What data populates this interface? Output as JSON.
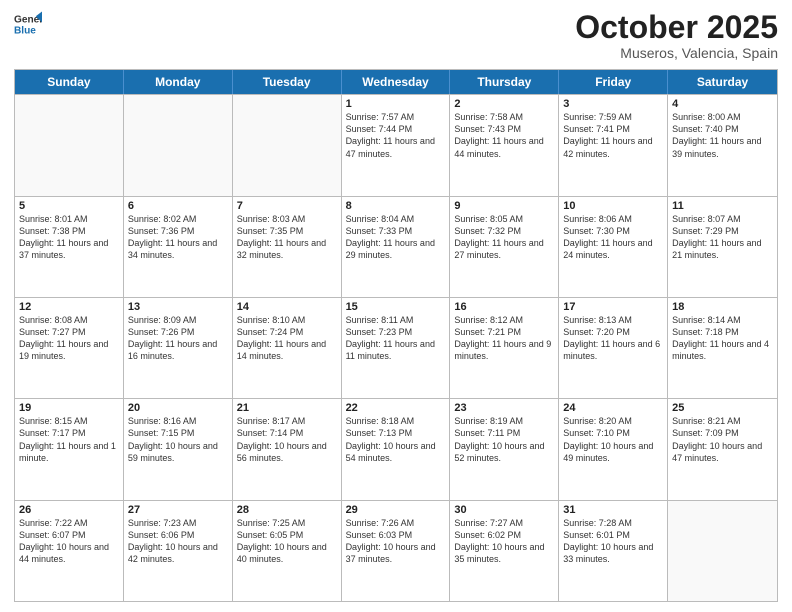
{
  "header": {
    "logo_general": "General",
    "logo_blue": "Blue",
    "month": "October 2025",
    "location": "Museros, Valencia, Spain"
  },
  "days_of_week": [
    "Sunday",
    "Monday",
    "Tuesday",
    "Wednesday",
    "Thursday",
    "Friday",
    "Saturday"
  ],
  "weeks": [
    [
      {
        "day": "",
        "info": ""
      },
      {
        "day": "",
        "info": ""
      },
      {
        "day": "",
        "info": ""
      },
      {
        "day": "1",
        "info": "Sunrise: 7:57 AM\nSunset: 7:44 PM\nDaylight: 11 hours and 47 minutes."
      },
      {
        "day": "2",
        "info": "Sunrise: 7:58 AM\nSunset: 7:43 PM\nDaylight: 11 hours and 44 minutes."
      },
      {
        "day": "3",
        "info": "Sunrise: 7:59 AM\nSunset: 7:41 PM\nDaylight: 11 hours and 42 minutes."
      },
      {
        "day": "4",
        "info": "Sunrise: 8:00 AM\nSunset: 7:40 PM\nDaylight: 11 hours and 39 minutes."
      }
    ],
    [
      {
        "day": "5",
        "info": "Sunrise: 8:01 AM\nSunset: 7:38 PM\nDaylight: 11 hours and 37 minutes."
      },
      {
        "day": "6",
        "info": "Sunrise: 8:02 AM\nSunset: 7:36 PM\nDaylight: 11 hours and 34 minutes."
      },
      {
        "day": "7",
        "info": "Sunrise: 8:03 AM\nSunset: 7:35 PM\nDaylight: 11 hours and 32 minutes."
      },
      {
        "day": "8",
        "info": "Sunrise: 8:04 AM\nSunset: 7:33 PM\nDaylight: 11 hours and 29 minutes."
      },
      {
        "day": "9",
        "info": "Sunrise: 8:05 AM\nSunset: 7:32 PM\nDaylight: 11 hours and 27 minutes."
      },
      {
        "day": "10",
        "info": "Sunrise: 8:06 AM\nSunset: 7:30 PM\nDaylight: 11 hours and 24 minutes."
      },
      {
        "day": "11",
        "info": "Sunrise: 8:07 AM\nSunset: 7:29 PM\nDaylight: 11 hours and 21 minutes."
      }
    ],
    [
      {
        "day": "12",
        "info": "Sunrise: 8:08 AM\nSunset: 7:27 PM\nDaylight: 11 hours and 19 minutes."
      },
      {
        "day": "13",
        "info": "Sunrise: 8:09 AM\nSunset: 7:26 PM\nDaylight: 11 hours and 16 minutes."
      },
      {
        "day": "14",
        "info": "Sunrise: 8:10 AM\nSunset: 7:24 PM\nDaylight: 11 hours and 14 minutes."
      },
      {
        "day": "15",
        "info": "Sunrise: 8:11 AM\nSunset: 7:23 PM\nDaylight: 11 hours and 11 minutes."
      },
      {
        "day": "16",
        "info": "Sunrise: 8:12 AM\nSunset: 7:21 PM\nDaylight: 11 hours and 9 minutes."
      },
      {
        "day": "17",
        "info": "Sunrise: 8:13 AM\nSunset: 7:20 PM\nDaylight: 11 hours and 6 minutes."
      },
      {
        "day": "18",
        "info": "Sunrise: 8:14 AM\nSunset: 7:18 PM\nDaylight: 11 hours and 4 minutes."
      }
    ],
    [
      {
        "day": "19",
        "info": "Sunrise: 8:15 AM\nSunset: 7:17 PM\nDaylight: 11 hours and 1 minute."
      },
      {
        "day": "20",
        "info": "Sunrise: 8:16 AM\nSunset: 7:15 PM\nDaylight: 10 hours and 59 minutes."
      },
      {
        "day": "21",
        "info": "Sunrise: 8:17 AM\nSunset: 7:14 PM\nDaylight: 10 hours and 56 minutes."
      },
      {
        "day": "22",
        "info": "Sunrise: 8:18 AM\nSunset: 7:13 PM\nDaylight: 10 hours and 54 minutes."
      },
      {
        "day": "23",
        "info": "Sunrise: 8:19 AM\nSunset: 7:11 PM\nDaylight: 10 hours and 52 minutes."
      },
      {
        "day": "24",
        "info": "Sunrise: 8:20 AM\nSunset: 7:10 PM\nDaylight: 10 hours and 49 minutes."
      },
      {
        "day": "25",
        "info": "Sunrise: 8:21 AM\nSunset: 7:09 PM\nDaylight: 10 hours and 47 minutes."
      }
    ],
    [
      {
        "day": "26",
        "info": "Sunrise: 7:22 AM\nSunset: 6:07 PM\nDaylight: 10 hours and 44 minutes."
      },
      {
        "day": "27",
        "info": "Sunrise: 7:23 AM\nSunset: 6:06 PM\nDaylight: 10 hours and 42 minutes."
      },
      {
        "day": "28",
        "info": "Sunrise: 7:25 AM\nSunset: 6:05 PM\nDaylight: 10 hours and 40 minutes."
      },
      {
        "day": "29",
        "info": "Sunrise: 7:26 AM\nSunset: 6:03 PM\nDaylight: 10 hours and 37 minutes."
      },
      {
        "day": "30",
        "info": "Sunrise: 7:27 AM\nSunset: 6:02 PM\nDaylight: 10 hours and 35 minutes."
      },
      {
        "day": "31",
        "info": "Sunrise: 7:28 AM\nSunset: 6:01 PM\nDaylight: 10 hours and 33 minutes."
      },
      {
        "day": "",
        "info": ""
      }
    ]
  ]
}
